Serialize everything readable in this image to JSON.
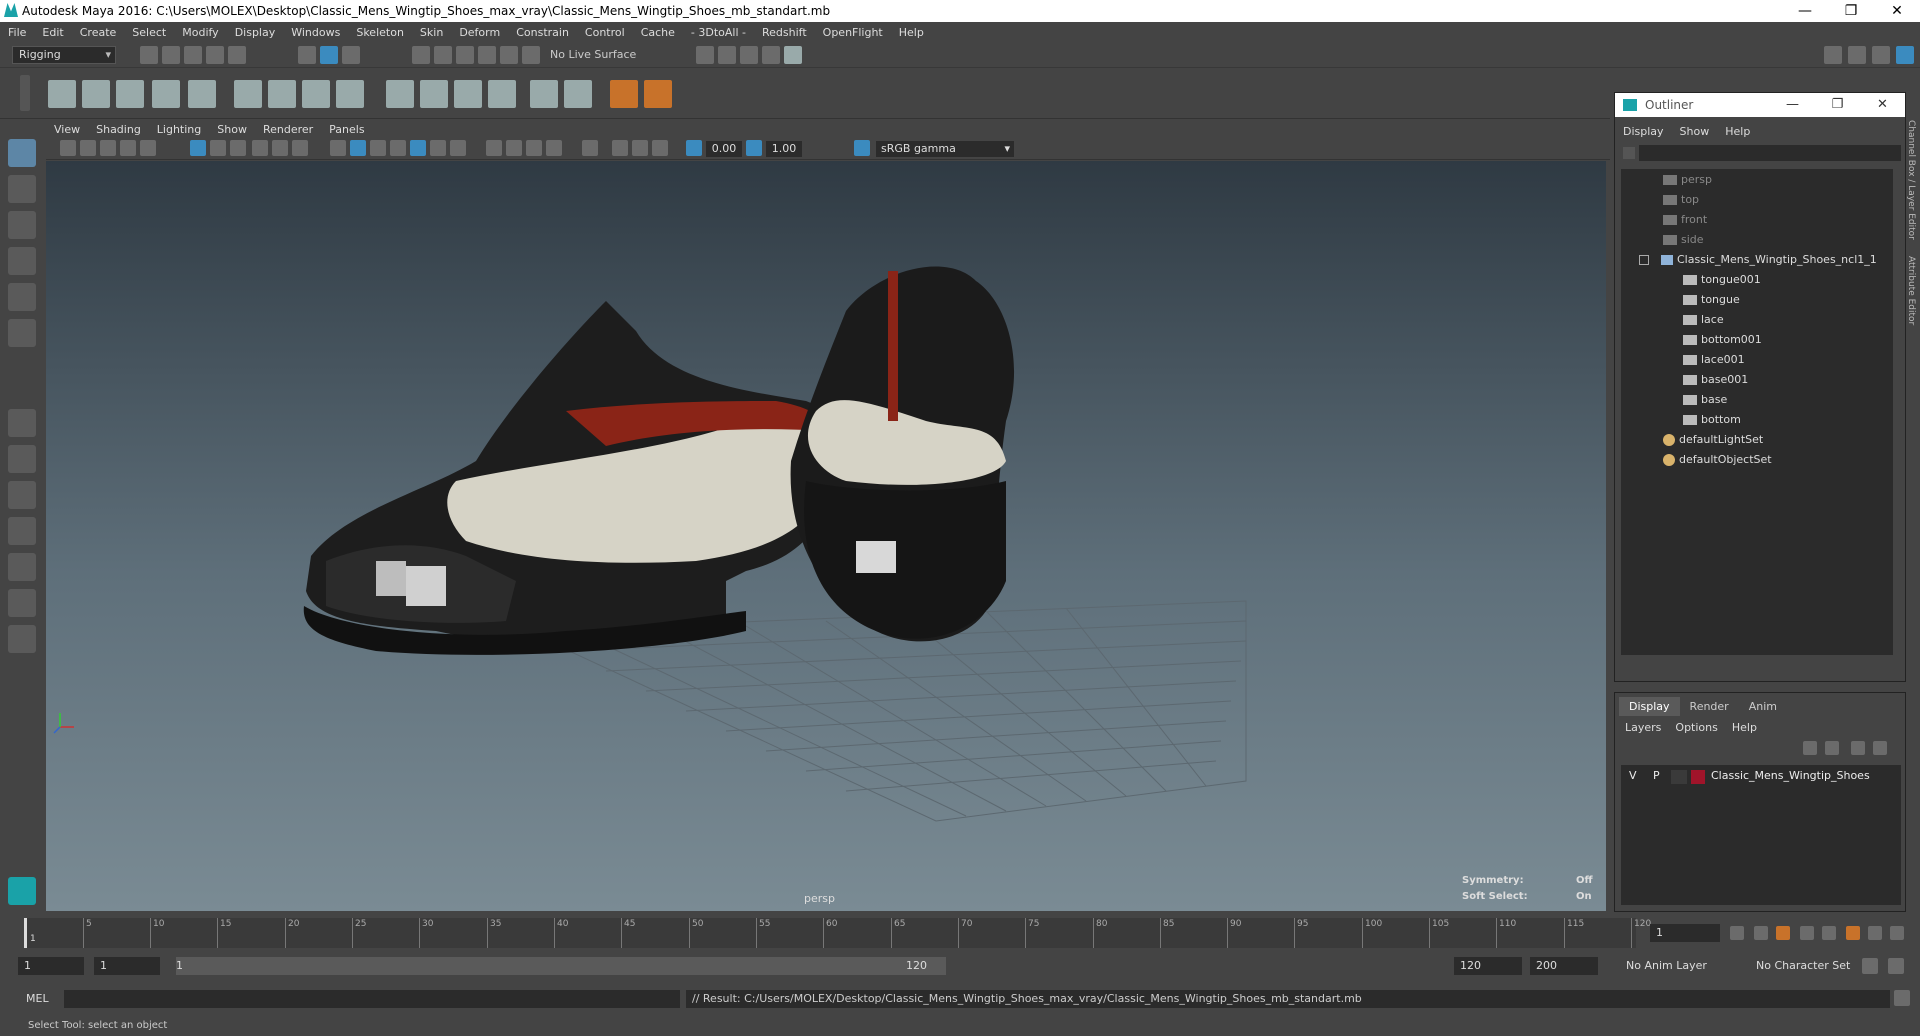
{
  "window": {
    "title": "Autodesk Maya 2016: C:\\Users\\MOLEX\\Desktop\\Classic_Mens_Wingtip_Shoes_max_vray\\Classic_Mens_Wingtip_Shoes_mb_standart.mb",
    "min": "—",
    "max": "❐",
    "close": "✕"
  },
  "menubar": [
    "File",
    "Edit",
    "Create",
    "Select",
    "Modify",
    "Display",
    "Windows",
    "Skeleton",
    "Skin",
    "Deform",
    "Constrain",
    "Control",
    "Cache",
    "- 3DtoAll -",
    "Redshift",
    "OpenFlight",
    "Help"
  ],
  "status": {
    "mode": "Rigging",
    "live_surface": "No Live Surface"
  },
  "viewport": {
    "menu": [
      "View",
      "Shading",
      "Lighting",
      "Show",
      "Renderer",
      "Panels"
    ],
    "exposure": "0.00",
    "gamma_value": "1.00",
    "color_space": "sRGB gamma",
    "camera_label": "persp",
    "hud": {
      "symmetry_label": "Symmetry:",
      "symmetry_value": "Off",
      "softsel_label": "Soft Select:",
      "softsel_value": "On"
    }
  },
  "outliner": {
    "title": "Outliner",
    "menu": [
      "Display",
      "Show",
      "Help"
    ],
    "cameras": [
      "persp",
      "top",
      "front",
      "side"
    ],
    "group": "Classic_Mens_Wingtip_Shoes_ncl1_1",
    "children": [
      "tongue001",
      "tongue",
      "lace",
      "bottom001",
      "lace001",
      "base001",
      "base",
      "bottom"
    ],
    "sets": [
      "defaultLightSet",
      "defaultObjectSet"
    ]
  },
  "layers": {
    "tabs": [
      "Display",
      "Render",
      "Anim"
    ],
    "menu": [
      "Layers",
      "Options",
      "Help"
    ],
    "row": {
      "v": "V",
      "p": "P",
      "name": "Classic_Mens_Wingtip_Shoes",
      "color": "#a0142a"
    }
  },
  "side_tabs": [
    "Channel Box / Layer Editor",
    "Attribute Editor"
  ],
  "timeline": {
    "ticks": [
      "5",
      "10",
      "15",
      "20",
      "25",
      "30",
      "35",
      "40",
      "45",
      "50",
      "55",
      "60",
      "65",
      "70",
      "75",
      "80",
      "85",
      "90",
      "95",
      "100",
      "105",
      "110",
      "115",
      "120"
    ],
    "current_frame": "1",
    "first_frame_marker": "1"
  },
  "range": {
    "start": "1",
    "start2": "1",
    "slider_start": "1",
    "slider_end": "120",
    "end": "120",
    "end2": "200",
    "anim_layer": "No Anim Layer",
    "char_set": "No Character Set"
  },
  "cmd": {
    "label": "MEL",
    "result": "// Result: C:/Users/MOLEX/Desktop/Classic_Mens_Wingtip_Shoes_max_vray/Classic_Mens_Wingtip_Shoes_mb_standart.mb"
  },
  "help_line": "Select Tool: select an object"
}
